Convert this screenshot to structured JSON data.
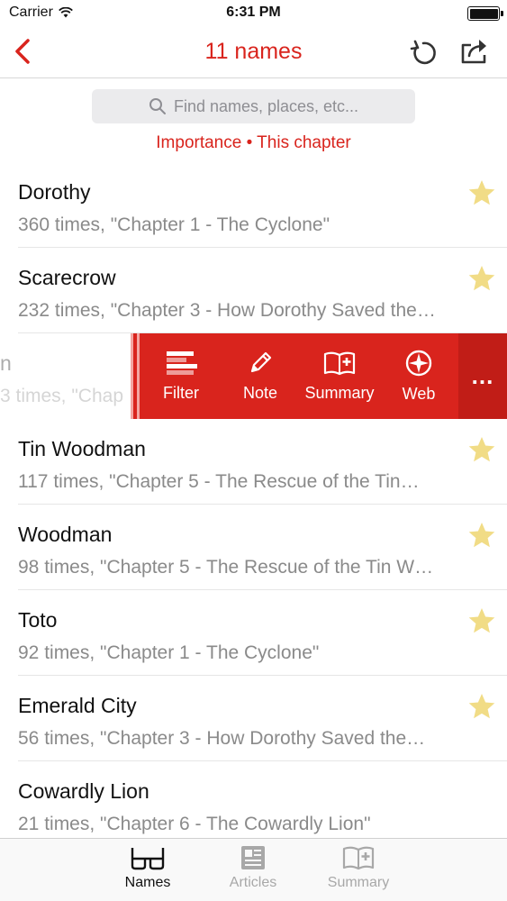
{
  "status_bar": {
    "carrier": "Carrier",
    "time": "6:31 PM"
  },
  "nav": {
    "title": "11 names"
  },
  "search": {
    "placeholder": "Find names, places, etc..."
  },
  "sort_line": "Importance • This chapter",
  "rows": [
    {
      "name": "Dorothy",
      "detail": "360 times, \"Chapter 1 - The Cyclone\"",
      "starred": true
    },
    {
      "name": "Scarecrow",
      "detail": "232 times, \"Chapter 3 - How Dorothy Saved the…",
      "starred": true
    },
    {
      "name": "n",
      "detail": "3 times, \"Chap",
      "starred": false
    },
    {
      "name": "Tin Woodman",
      "detail": "117 times, \"Chapter 5 - The Rescue of the Tin…",
      "starred": true
    },
    {
      "name": "Woodman",
      "detail": "98 times, \"Chapter 5 - The Rescue of the Tin W…",
      "starred": true
    },
    {
      "name": "Toto",
      "detail": "92 times, \"Chapter 1 - The Cyclone\"",
      "starred": true
    },
    {
      "name": "Emerald City",
      "detail": "56 times, \"Chapter 3 - How Dorothy Saved the…",
      "starred": true
    },
    {
      "name": "Cowardly Lion",
      "detail": "21 times, \"Chapter 6 - The Cowardly Lion\"",
      "starred": false
    }
  ],
  "swipe_actions": {
    "filter": "Filter",
    "note": "Note",
    "summary": "Summary",
    "web": "Web",
    "more": "..."
  },
  "tabs": [
    {
      "label": "Names",
      "icon": "glasses-icon",
      "active": true
    },
    {
      "label": "Articles",
      "icon": "newspaper-icon",
      "active": false
    },
    {
      "label": "Summary",
      "icon": "book-plus-icon",
      "active": false
    }
  ],
  "colors": {
    "accent": "#d9241d",
    "star": "#f1dc86",
    "detail_text": "#8a8a8a"
  }
}
